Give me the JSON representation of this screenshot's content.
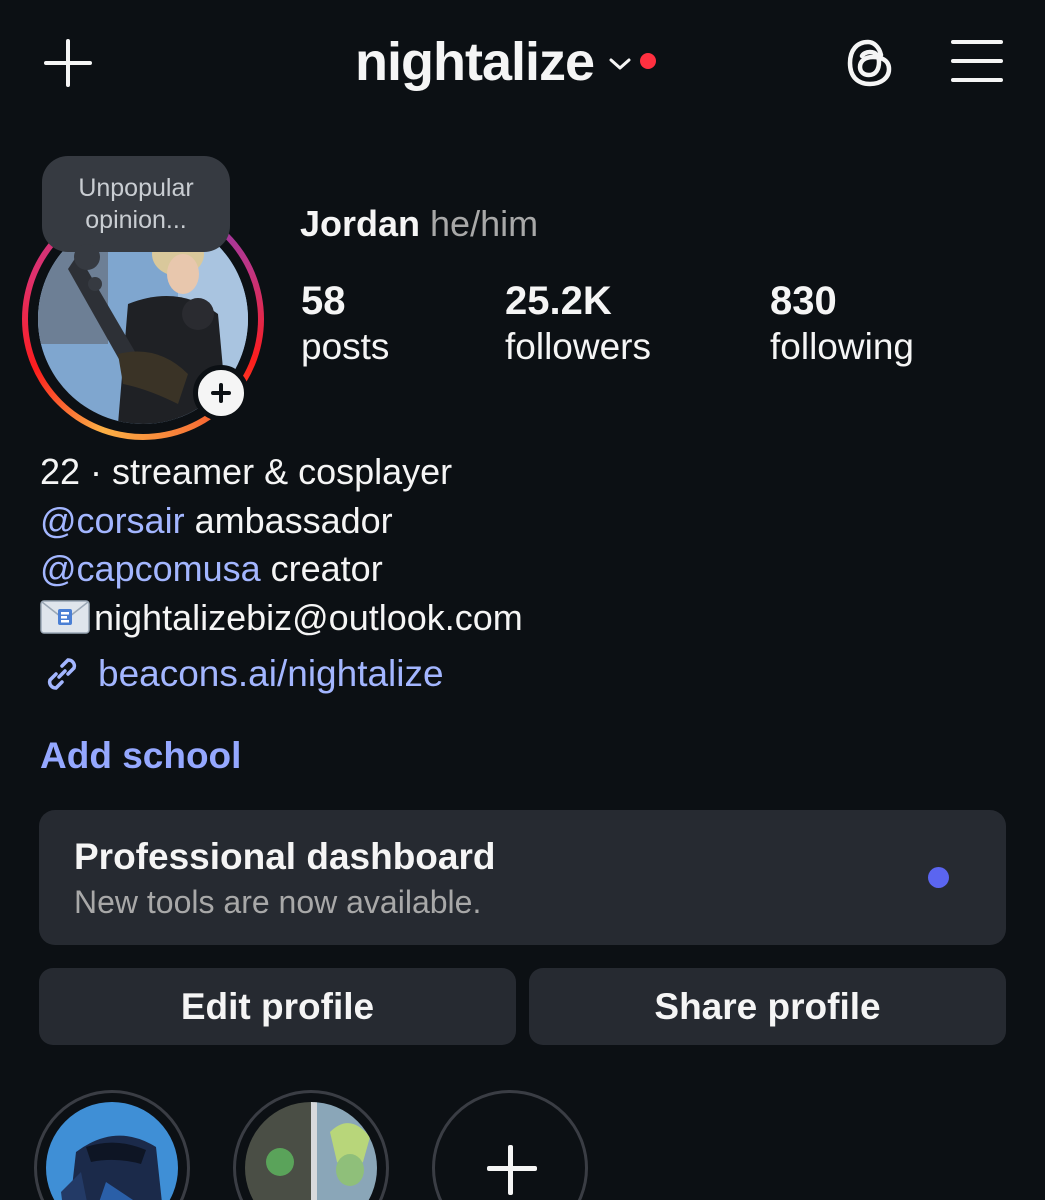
{
  "header": {
    "username": "nightalize",
    "create_icon": "plus-icon",
    "threads_icon": "threads-icon",
    "menu_icon": "hamburger-menu-icon",
    "notification_color": "#ff3040"
  },
  "note": {
    "text": "Unpopular opinion..."
  },
  "profile": {
    "display_name": "Jordan",
    "pronouns": "he/him",
    "story_ring_colors": [
      "#fcb045",
      "#fd1d1d",
      "#e1306c",
      "#833ab4"
    ]
  },
  "stats": [
    {
      "value": "58",
      "label": "posts"
    },
    {
      "value": "25.2K",
      "label": "followers"
    },
    {
      "value": "830",
      "label": "following"
    }
  ],
  "bio": {
    "line1": "22 · streamer & cosplayer",
    "mention1": "@corsair",
    "mention1_suffix": " ambassador",
    "mention2": "@capcomusa",
    "mention2_suffix": " creator",
    "email_icon": "envelope-emoji-icon",
    "email": "nightalizebiz@outlook.com",
    "link_icon": "link-icon",
    "link": "beacons.ai/nightalize",
    "mention_color": "#a3b6ff"
  },
  "add_school": "Add school",
  "dashboard": {
    "title": "Professional dashboard",
    "subtitle": "New tools are now available.",
    "dot_color": "#5b65f0"
  },
  "buttons": {
    "edit": "Edit profile",
    "share": "Share profile"
  },
  "highlights": [
    {
      "kind": "cover",
      "icon": "highlight-cover-1"
    },
    {
      "kind": "cover",
      "icon": "highlight-cover-2"
    },
    {
      "kind": "new",
      "icon": "plus-icon"
    }
  ]
}
